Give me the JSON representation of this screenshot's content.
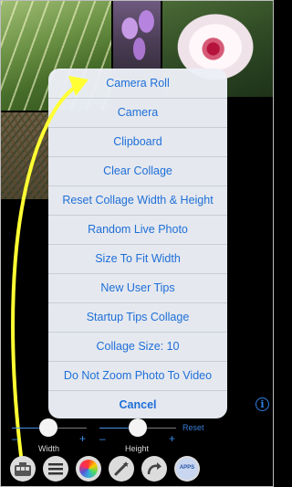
{
  "menu": {
    "items": [
      "Camera Roll",
      "Camera",
      "Clipboard",
      "Clear Collage",
      "Reset Collage Width & Height",
      "Random Live Photo",
      "Size To Fit Width",
      "New User Tips",
      "Startup Tips Collage",
      "Collage Size: 10",
      "Do Not Zoom Photo To Video"
    ],
    "cancel": "Cancel"
  },
  "controls": {
    "width_label": "Width",
    "height_label": "Height",
    "reset_label": "Reset",
    "minus": "–",
    "plus": "+",
    "width_value": 0.35,
    "height_value": 0.45
  },
  "toolbar": {
    "icons": [
      "collage-grid-icon",
      "menu-lines-icon",
      "color-wheel-icon",
      "wand-icon",
      "redo-arrow-icon",
      "apps-badge-icon"
    ],
    "apps_label": "APPS"
  },
  "colors": {
    "accent": "#1e6fd9",
    "arrow": "#ffff33",
    "menu_bg": "#ecf0f6"
  }
}
